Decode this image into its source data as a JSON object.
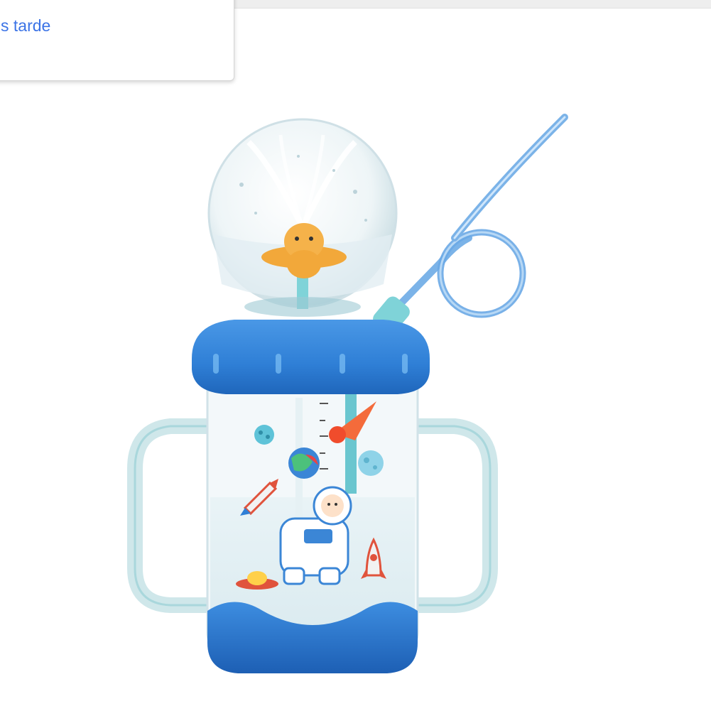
{
  "popup": {
    "link_text": "s tarde"
  },
  "colors": {
    "lid_blue": "#2f7fd6",
    "base_blue": "#2a72cc",
    "accent_teal": "#7fd3d8",
    "link_blue": "#3b73e6",
    "duck_orange": "#f0a43a"
  },
  "icons": {
    "rocket": "rocket-icon",
    "planet": "planet-icon",
    "astronaut": "astronaut-icon",
    "comet": "comet-icon",
    "ufo": "ufo-icon"
  }
}
